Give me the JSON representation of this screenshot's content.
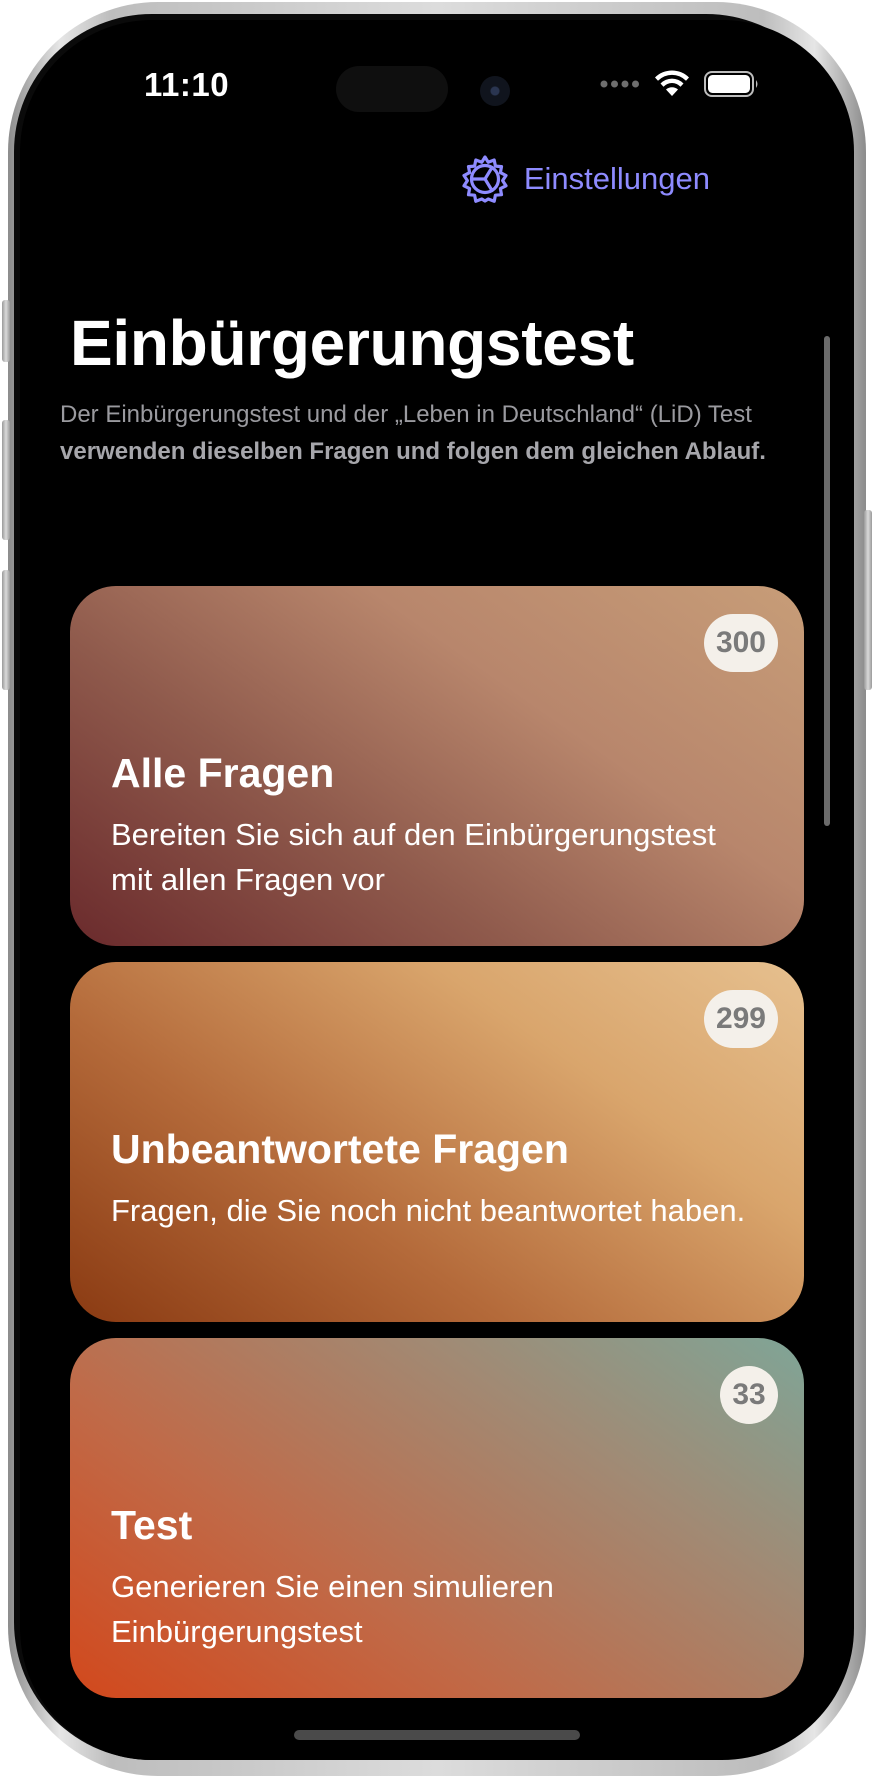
{
  "status_bar": {
    "time": "11:10",
    "icons": [
      "signal-dots-icon",
      "wifi-icon",
      "battery-icon"
    ]
  },
  "header": {
    "settings_label": "Einstellungen",
    "settings_icon": "gear-icon",
    "accent_color": "#8e8bff"
  },
  "main": {
    "title": "Einbürgerungstest",
    "intro_plain": "Der Einbürgerungstest und der „Leben in Deutschland“ (LiD) Test ",
    "intro_bold": "verwenden dieselben Fragen und folgen dem gleichen Ablauf."
  },
  "cards": [
    {
      "title": "Alle Fragen",
      "description": "Bereiten Sie sich auf den Einbürgerungstest mit allen Fragen vor",
      "count": "300"
    },
    {
      "title": "Unbeantwortete Fragen",
      "description": "Fragen, die Sie noch nicht beantwortet haben.",
      "count": "299"
    },
    {
      "title": "Test",
      "description": "Generieren Sie einen simulieren Einbürgerungstest",
      "count": "33"
    }
  ]
}
